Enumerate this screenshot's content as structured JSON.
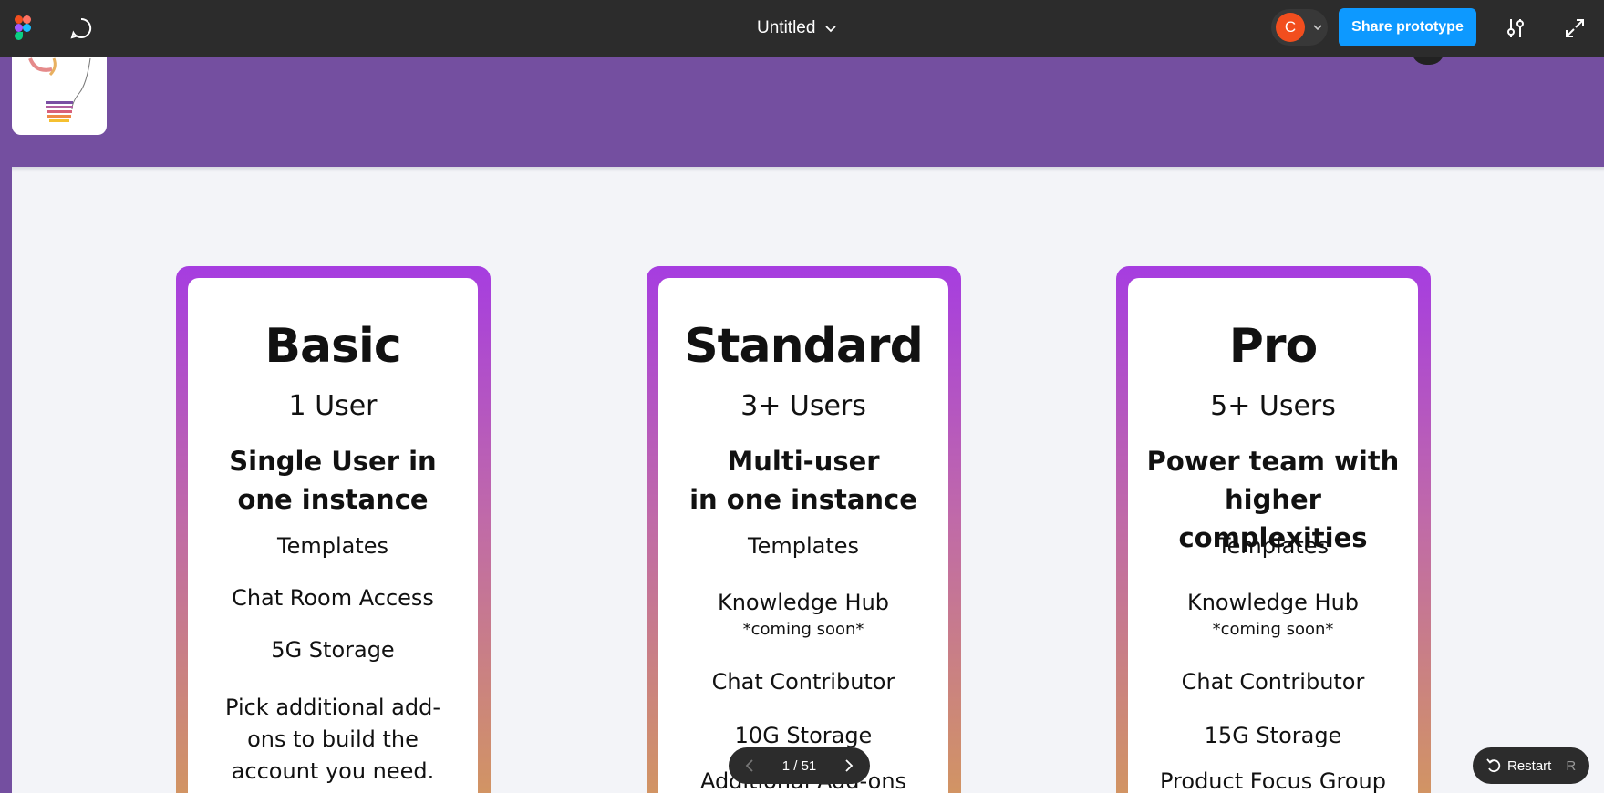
{
  "toolbar": {
    "file_title": "Untitled",
    "avatar_initial": "C",
    "share_label": "Share prototype"
  },
  "plans": [
    {
      "title": "Basic",
      "users": "1 User",
      "tagline_line1": "Single User in",
      "tagline_line2": "one instance",
      "features": [
        {
          "text": "Templates",
          "note": ""
        },
        {
          "text": "Chat Room Access",
          "note": ""
        },
        {
          "text": "5G Storage",
          "note": ""
        },
        {
          "text": "Pick additional add-ons to build the account you need.",
          "note": ""
        }
      ]
    },
    {
      "title": "Standard",
      "users": "3+ Users",
      "tagline_line1": "Multi-user",
      "tagline_line2": "in one instance",
      "features": [
        {
          "text": "Templates",
          "note": ""
        },
        {
          "text": "Knowledge Hub",
          "note": "*coming soon*"
        },
        {
          "text": "Chat Contributor",
          "note": ""
        },
        {
          "text": "10G Storage",
          "note": ""
        },
        {
          "text": "Additional Add-ons",
          "note": ""
        }
      ]
    },
    {
      "title": "Pro",
      "users": "5+ Users",
      "tagline_line1": "Power team with",
      "tagline_line2": "higher complexities",
      "features": [
        {
          "text": "Templates",
          "note": ""
        },
        {
          "text": "Knowledge Hub",
          "note": "*coming soon*"
        },
        {
          "text": "Chat Contributor",
          "note": ""
        },
        {
          "text": "15G Storage",
          "note": ""
        },
        {
          "text": "Product Focus Group",
          "note": ""
        }
      ]
    }
  ],
  "pager": {
    "label": "1 / 51"
  },
  "restart": {
    "label": "Restart",
    "shortcut": "R"
  },
  "colors": {
    "toolbar_bg": "#2c2c2c",
    "share_button": "#0d99ff",
    "avatar": "#f24e1e",
    "header_purple": "#744fa0",
    "card_gradient_top": "#a63de0",
    "card_gradient_bottom": "#d49a5a"
  }
}
